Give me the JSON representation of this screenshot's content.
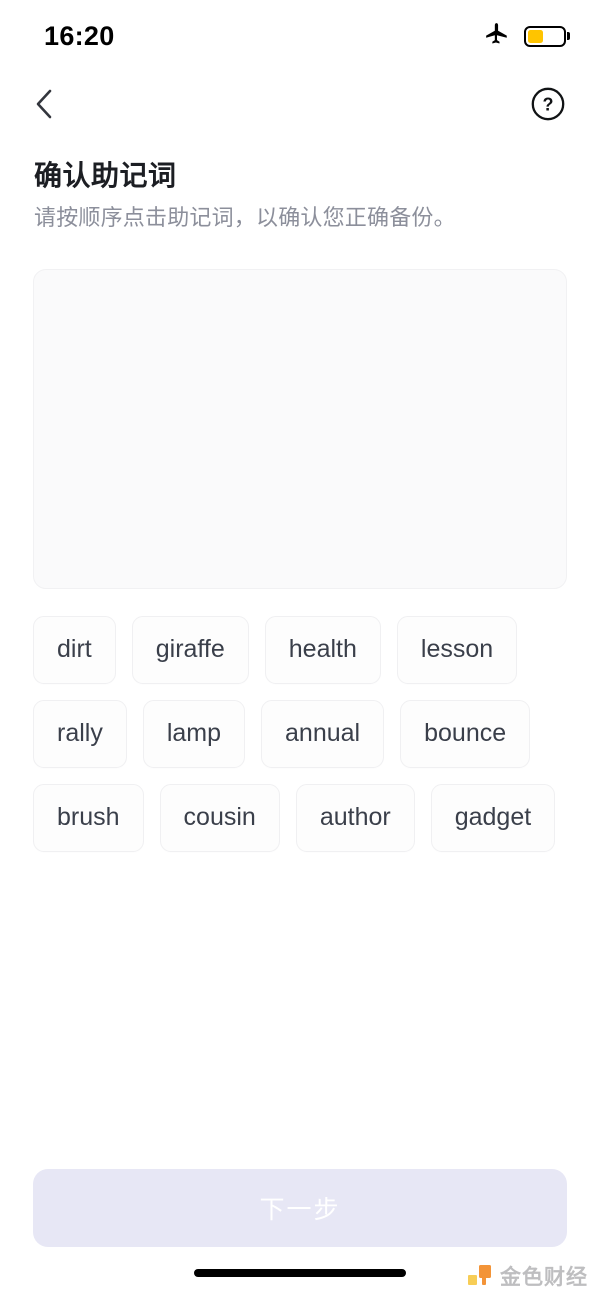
{
  "status_bar": {
    "time": "16:20",
    "airplane_icon": "airplane-mode-icon",
    "battery_icon": "battery-icon",
    "battery_level_percent": 45,
    "battery_color": "#FFC400"
  },
  "nav_bar": {
    "back_icon": "chevron-left-icon",
    "help_icon": "question-mark-circle-icon"
  },
  "heading": {
    "title": "确认助记词",
    "subtitle": "请按顺序点击助记词，以确认您正确备份。"
  },
  "answer_box": {
    "selected_words": [],
    "placeholder": ""
  },
  "word_bank": {
    "words": [
      "dirt",
      "giraffe",
      "health",
      "lesson",
      "rally",
      "lamp",
      "annual",
      "bounce",
      "brush",
      "cousin",
      "author",
      "gadget"
    ]
  },
  "footer": {
    "next_label": "下一步",
    "next_enabled": false,
    "next_bg_color": "#E7E7F5",
    "next_text_color": "#FFFFFF"
  },
  "bottom_bar": {
    "home_indicator": "home-indicator",
    "watermark_text": "金色财经",
    "watermark_logo_color": "#F5A623"
  }
}
